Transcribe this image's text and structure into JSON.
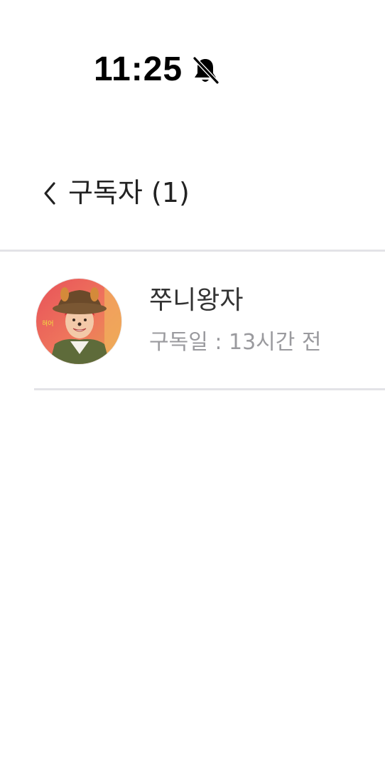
{
  "status_bar": {
    "time": "11:25",
    "icon": "bell-slash-icon"
  },
  "header": {
    "back_icon": "chevron-left-icon",
    "title": "구독자 (1)"
  },
  "subscribers": [
    {
      "name": "쭈니왕자",
      "subscribed": "구독일 : 13시간 전",
      "avatar": "profile-photo"
    }
  ],
  "colors": {
    "divider": "#e3e3e7",
    "secondary_text": "#9a9a9e",
    "primary_text": "#222222"
  }
}
